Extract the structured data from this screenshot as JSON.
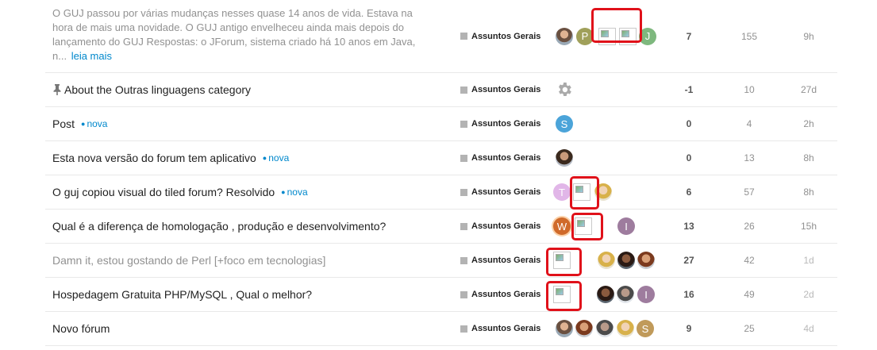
{
  "topics": [
    {
      "excerpt": "O GUJ passou por várias mudanças nesses quase 14 anos de vida. Estava na hora de mais uma novidade. O GUJ antigo envelheceu ainda mais depois do lançamento do GUJ Respostas: o JForum, sistema criado há 10 anos em Java, n...",
      "read_more": "leia mais",
      "category": "Assuntos Gerais",
      "posters": [
        {
          "kind": "photo",
          "letter": ""
        },
        {
          "kind": "letter",
          "letter": "P",
          "color": "#a0a05a"
        },
        {
          "kind": "broken",
          "letter": ""
        },
        {
          "kind": "broken",
          "letter": ""
        },
        {
          "kind": "letter",
          "letter": "J",
          "color": "#7eb87e"
        }
      ],
      "replies": "7",
      "views": "155",
      "activity": "9h"
    },
    {
      "title": "About the Outras linguagens category",
      "pinned": true,
      "category": "Assuntos Gerais",
      "posters": [
        {
          "kind": "gear-icon"
        }
      ],
      "replies": "-1",
      "views": "10",
      "activity": "27d"
    },
    {
      "title": "Post",
      "badge": "nova",
      "category": "Assuntos Gerais",
      "posters": [
        {
          "kind": "letter",
          "letter": "S",
          "color": "#4ba4d9"
        }
      ],
      "replies": "0",
      "views": "4",
      "activity": "2h"
    },
    {
      "title": "Esta nova versão do forum tem aplicativo",
      "badge": "nova",
      "category": "Assuntos Gerais",
      "posters": [
        {
          "kind": "photo",
          "letter": ""
        }
      ],
      "replies": "0",
      "views": "13",
      "activity": "8h"
    },
    {
      "title": "O guj copiou visual do tiled forum? Resolvido",
      "badge": "nova",
      "category": "Assuntos Gerais",
      "posters": [
        {
          "kind": "letter",
          "letter": "T",
          "color": "#e1b6e8"
        },
        {
          "kind": "broken",
          "letter": ""
        },
        {
          "kind": "photo",
          "letter": ""
        }
      ],
      "replies": "6",
      "views": "57",
      "activity": "8h"
    },
    {
      "title": "Qual é a diferença de homologação , produção e desenvolvimento?",
      "category": "Assuntos Gerais",
      "posters": [
        {
          "kind": "letter",
          "letter": "W",
          "color": "#d06a2a"
        },
        {
          "kind": "broken",
          "letter": ""
        },
        {
          "kind": "letter",
          "letter": "I",
          "color": "#9e7c9e"
        }
      ],
      "replies": "13",
      "views": "26",
      "activity": "15h"
    },
    {
      "title": "Damn it, estou gostando de Perl [+foco em tecnologias]",
      "visited": true,
      "category": "Assuntos Gerais",
      "posters": [
        {
          "kind": "broken",
          "letter": ""
        },
        {
          "kind": "photo",
          "letter": ""
        },
        {
          "kind": "photo",
          "letter": ""
        },
        {
          "kind": "photo",
          "letter": ""
        }
      ],
      "replies": "27",
      "views": "42",
      "activity": "1d"
    },
    {
      "title": "Hospedagem Gratuita PHP/MySQL , Qual o melhor?",
      "category": "Assuntos Gerais",
      "posters": [
        {
          "kind": "broken",
          "letter": ""
        },
        {
          "kind": "photo",
          "letter": ""
        },
        {
          "kind": "photo",
          "letter": ""
        },
        {
          "kind": "letter",
          "letter": "I",
          "color": "#9e7c9e"
        }
      ],
      "replies": "16",
      "views": "49",
      "activity": "2d"
    },
    {
      "title": "Novo fórum",
      "category": "Assuntos Gerais",
      "posters": [
        {
          "kind": "photo",
          "letter": ""
        },
        {
          "kind": "photo",
          "letter": ""
        },
        {
          "kind": "photo",
          "letter": ""
        },
        {
          "kind": "photo",
          "letter": ""
        },
        {
          "kind": "letter",
          "letter": "S",
          "color": "#c09a5a"
        }
      ],
      "replies": "9",
      "views": "25",
      "activity": "4d"
    }
  ],
  "colors": {
    "link": "#0088cc",
    "highlight": "#e0111a",
    "category_square": "#b3b3b3"
  }
}
